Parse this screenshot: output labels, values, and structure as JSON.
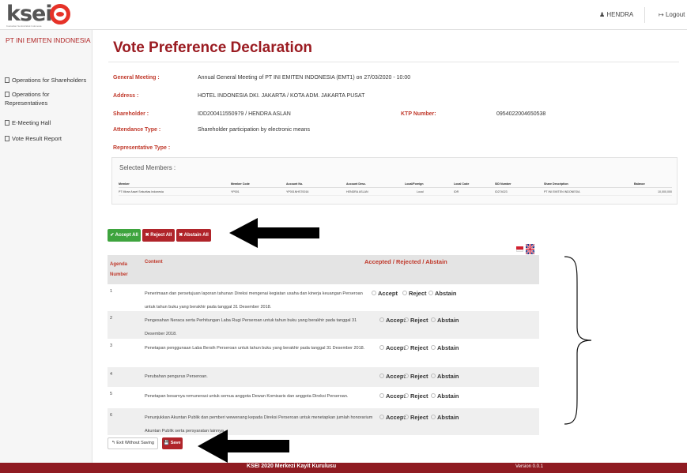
{
  "header": {
    "logo_text": "ksei",
    "logo_subtext": "Kustodian Sentral Efek Indonesia",
    "user_name": "HENDRA",
    "logout_label": "Logout"
  },
  "sidebar": {
    "company": "PT INI EMITEN INDONESIA",
    "items": [
      {
        "label": "Operations for Shareholders"
      },
      {
        "label": "Operations for Representatives"
      },
      {
        "label": "E-Meeting Hall"
      },
      {
        "label": "Vote Result Report"
      }
    ]
  },
  "main": {
    "title": "Vote Preference Declaration",
    "general_meeting_label": "General Meeting :",
    "general_meeting_value": "Annual General Meeting of PT INI EMITEN INDONESIA (EMT1) on 27/03/2020 - 10:00",
    "address_label": "Address :",
    "address_value": "HOTEL INDONESIA DKI. JAKARTA / KOTA ADM. JAKARTA PUSAT",
    "shareholder_label": "Shareholder :",
    "shareholder_value": "IDD200411550979 / HENDRA ASLAN",
    "ktp_label": "KTP Number:",
    "ktp_value": "0954022004650538",
    "attendance_label": "Attendance Type :",
    "attendance_value": "Shareholder participation by electronic means",
    "representative_label": "Representative Type :"
  },
  "members": {
    "title": "Selected Members :",
    "headers": [
      "Member",
      "Member Code",
      "Account No.",
      "Account Desc.",
      "Local/Foreign",
      "Local Code",
      "SID Number",
      "Share Description",
      "Balance"
    ],
    "row": [
      "PT Mirae Asset Sekuritas Indonesia",
      "YP001",
      "YP001NHS70016",
      "HENDRA ASLAN",
      "Local",
      "IDR",
      "ID274023",
      "PT INI EMITEN INDONESIA",
      "10,000,000"
    ]
  },
  "actions": {
    "accept_all": "✔ Accept All",
    "reject_all": "✖ Reject All",
    "abstain_all": "✖ Abstain All"
  },
  "agenda": {
    "col_agenda": "Agenda Number",
    "col_content": "Content",
    "col_choice": "Accepted / Rejected / Abstain",
    "option_accept": "Accept",
    "option_reject": "Reject",
    "option_abstain": "Abstain",
    "rows": [
      {
        "num": "1",
        "text": "Penerimaan dan persetujuan laporan tahunan Direksi mengenai kegiatan usaha dan kinerja keuangan Perseroan untuk tahun buku yang berakhir pada tanggal 31 Desember 2018."
      },
      {
        "num": "2",
        "text": "Pengesahan Neraca serta Perhitungan Laba Rugi Perseroan untuk tahun buku yang berakhir pada tanggal 31 Desember 2018."
      },
      {
        "num": "3",
        "text": "Penetapan penggunaan Laba Bersih Perseroan untuk tahun buku yang berakhir pada tanggal 31 Desember 2018."
      },
      {
        "num": "4",
        "text": "Perubahan pengurus Perseroan."
      },
      {
        "num": "5",
        "text": "Penetapan besarnya remunerasi untuk semua anggota Dewan Komisaris dan anggota Direksi Perseroan."
      },
      {
        "num": "6",
        "text": "Penunjukkan Akuntan Publik dan pemberi wewenang kepada Direksi Perseroan untuk menetapkan jumlah honorarium Akuntan Publik serta persyaratan lainnya."
      }
    ]
  },
  "bottom": {
    "exit_label": "↰ Exit Without Saving",
    "save_label": "Save"
  },
  "footer": {
    "copyright": "KSEI 2020 Merkezi Kayit Kurulusu",
    "version": "Version 0.0.1"
  },
  "colors": {
    "brand_red": "#9b1c22",
    "accept_green": "#3ea43e",
    "button_red": "#b0242a"
  }
}
